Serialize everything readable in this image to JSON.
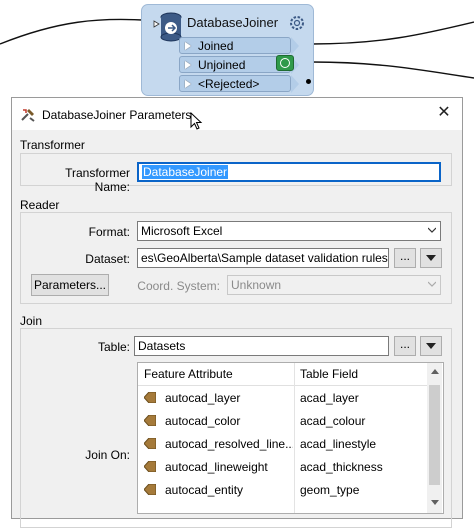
{
  "canvas": {
    "node_title": "DatabaseJoiner",
    "ports": [
      {
        "label": "Joined"
      },
      {
        "label": "Unjoined"
      },
      {
        "label": "<Rejected>"
      }
    ]
  },
  "dialog": {
    "title": "DatabaseJoiner Parameters",
    "close_symbol": "✕",
    "transformer": {
      "group_title": "Transformer",
      "name_label": "Transformer Name:",
      "name_value": "DatabaseJoiner"
    },
    "reader": {
      "group_title": "Reader",
      "format_label": "Format:",
      "format_value": "Microsoft Excel",
      "dataset_label": "Dataset:",
      "dataset_value": "es\\GeoAlberta\\Sample dataset validation rules.xlsx\"",
      "ellipsis": "...",
      "parameters_button": "Parameters...",
      "coord_label": "Coord. System:",
      "coord_value": "Unknown"
    },
    "join": {
      "group_title": "Join",
      "table_label": "Table:",
      "table_value": "Datasets",
      "ellipsis": "...",
      "join_on_label": "Join On:",
      "columns": [
        "Feature Attribute",
        "Table Field"
      ],
      "rows": [
        {
          "attr": "autocad_layer",
          "field": "acad_layer"
        },
        {
          "attr": "autocad_color",
          "field": "acad_colour"
        },
        {
          "attr": "autocad_resolved_line...",
          "field": "acad_linestyle"
        },
        {
          "attr": "autocad_lineweight",
          "field": "acad_thickness"
        },
        {
          "attr": "autocad_entity",
          "field": "geom_type"
        }
      ]
    }
  },
  "colors": {
    "node_fill": "#c5d9ee",
    "port_fill": "#b3cde8",
    "focus_border": "#0a64c8",
    "selection": "#3399ff",
    "inspect_green": "#2f9a4a"
  }
}
